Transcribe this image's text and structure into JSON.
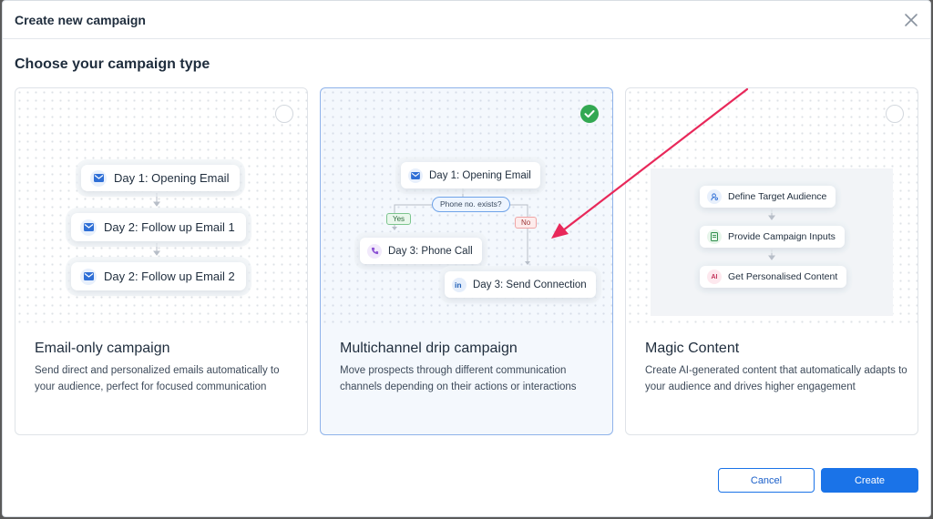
{
  "dialog": {
    "title": "Create new campaign",
    "section_title": "Choose your campaign type"
  },
  "cards": [
    {
      "name": "Email-only campaign",
      "description": "Send direct and personalized emails automatically to your audience, perfect for focused communication",
      "selected": false,
      "steps": [
        "Day 1: Opening Email",
        "Day 2: Follow up Email 1",
        "Day 2: Follow up Email 2"
      ]
    },
    {
      "name": "Multichannel drip campaign",
      "description": "Move prospects through different communication channels depending on their actions or interactions",
      "selected": true,
      "flow": {
        "start": "Day 1: Opening Email",
        "decision": "Phone no. exists?",
        "yes_label": "Yes",
        "no_label": "No",
        "yes_step": "Day 3: Phone Call",
        "no_step": "Day 3: Send Connection"
      }
    },
    {
      "name": "Magic Content",
      "description": "Create AI-generated content that automatically adapts to your audience and drives higher engagement",
      "selected": false,
      "steps": [
        "Define Target Audience",
        "Provide Campaign Inputs",
        "Get Personalised Content"
      ],
      "ai_badge": "AI"
    }
  ],
  "footer": {
    "cancel_label": "Cancel",
    "create_label": "Create"
  },
  "colors": {
    "primary": "#1a73e8",
    "selected_check": "#33a852",
    "annotation_arrow": "#e8285a"
  }
}
